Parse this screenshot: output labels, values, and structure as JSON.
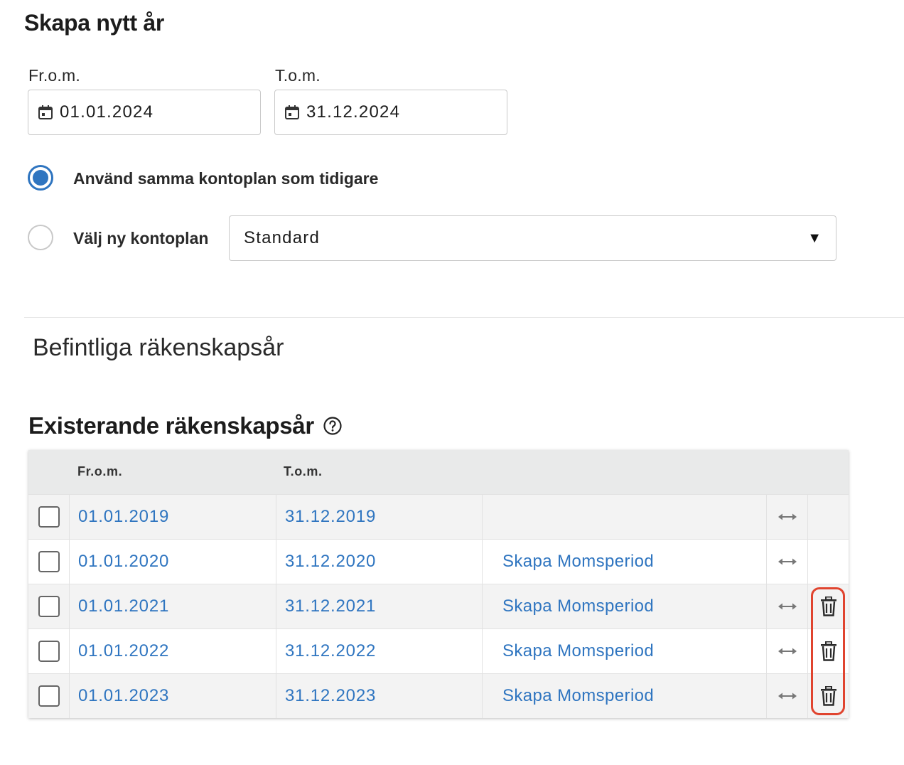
{
  "form": {
    "title": "Skapa nytt år",
    "from_label": "Fr.o.m.",
    "from_value": "01.01.2024",
    "to_label": "T.o.m.",
    "to_value": "31.12.2024",
    "option_same_label": "Använd samma kontoplan som tidigare",
    "option_new_label": "Välj ny kontoplan",
    "account_plan_selected": "Standard",
    "selected_option": "same",
    "icons": {
      "date": "calendar-icon",
      "select": "dropdown-arrow-icon"
    }
  },
  "existing": {
    "subtitle": "Befintliga räkenskapsår",
    "title": "Existerande räkenskapsår",
    "help_icon": "help-circle-icon",
    "columns": {
      "from": "Fr.o.m.",
      "to": "T.o.m."
    },
    "rows": [
      {
        "from": "01.01.2019",
        "to": "31.12.2019",
        "action": "",
        "delete": false
      },
      {
        "from": "01.01.2020",
        "to": "31.12.2020",
        "action": "Skapa Momsperiod",
        "delete": false
      },
      {
        "from": "01.01.2021",
        "to": "31.12.2021",
        "action": "Skapa Momsperiod",
        "delete": true
      },
      {
        "from": "01.01.2022",
        "to": "31.12.2022",
        "action": "Skapa Momsperiod",
        "delete": true
      },
      {
        "from": "01.01.2023",
        "to": "31.12.2023",
        "action": "Skapa Momsperiod",
        "delete": true
      }
    ],
    "row_icons": {
      "move": "resize-horizontal-icon",
      "delete": "trash-icon"
    }
  },
  "colors": {
    "accent": "#2f75c0",
    "highlight": "#e0442f",
    "header_bg": "#e9eaea"
  }
}
